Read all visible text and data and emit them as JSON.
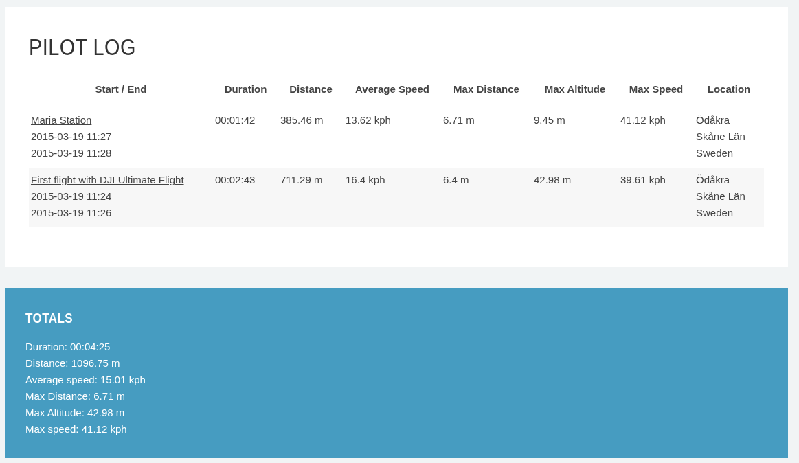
{
  "title": "PILOT LOG",
  "table": {
    "columns": [
      "Start / End",
      "Duration",
      "Distance",
      "Average Speed",
      "Max Distance",
      "Max Altitude",
      "Max Speed",
      "Location"
    ],
    "rows": [
      {
        "name": "Maria Station",
        "start": "2015-03-19 11:27",
        "end": "2015-03-19 11:28",
        "duration": "00:01:42",
        "distance": "385.46 m",
        "average_speed": "13.62 kph",
        "max_distance": "6.71 m",
        "max_altitude": "9.45 m",
        "max_speed": "41.12 kph",
        "location": [
          "Ödåkra",
          "Skåne Län",
          "Sweden"
        ]
      },
      {
        "name": "First flight with DJI Ultimate Flight",
        "start": "2015-03-19 11:24",
        "end": "2015-03-19 11:26",
        "duration": "00:02:43",
        "distance": "711.29 m",
        "average_speed": "16.4 kph",
        "max_distance": "6.4 m",
        "max_altitude": "42.98 m",
        "max_speed": "39.61 kph",
        "location": [
          "Ödåkra",
          "Skåne Län",
          "Sweden"
        ]
      }
    ]
  },
  "totals": {
    "title": "TOTALS",
    "lines": [
      "Duration: 00:04:25",
      "Distance: 1096.75 m",
      "Average speed: 15.01 kph",
      "Max Distance: 6.71 m",
      "Max Altitude: 42.98 m",
      "Max speed: 41.12 kph"
    ]
  }
}
